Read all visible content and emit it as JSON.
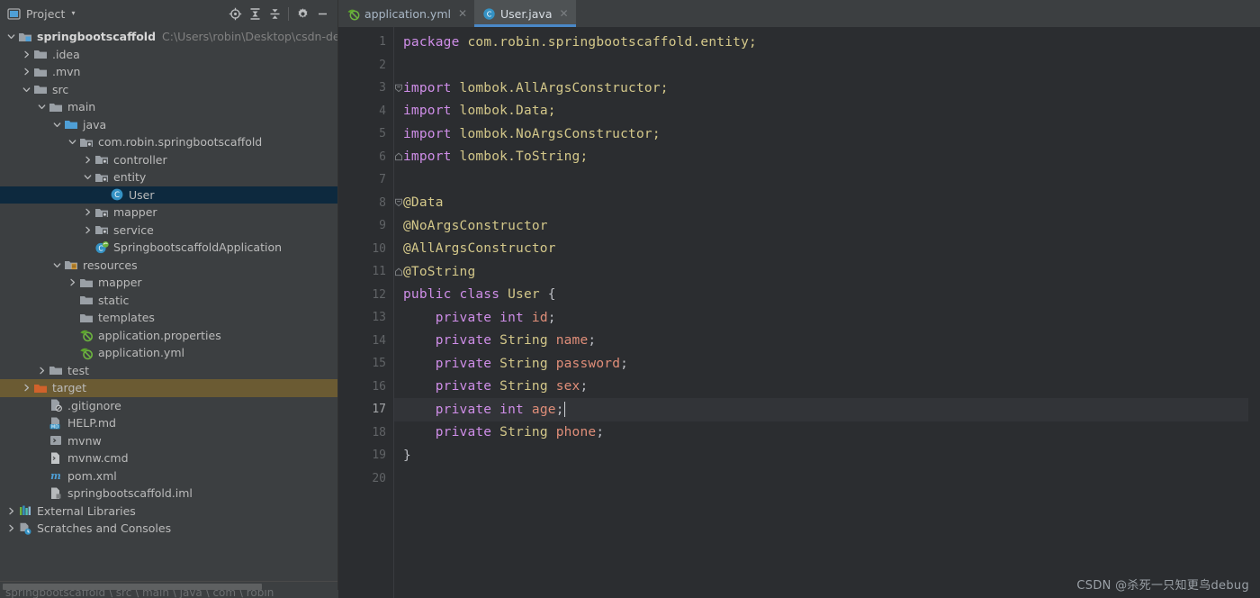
{
  "window": {
    "tool_window_title": "Project",
    "caret_glyph": "▾"
  },
  "toolbar": {
    "buttons": [
      {
        "name": "locate-icon",
        "title": "Select Opened File"
      },
      {
        "name": "expand-all-icon",
        "title": "Expand All"
      },
      {
        "name": "collapse-all-icon",
        "title": "Collapse All"
      },
      {
        "name": "gear-icon",
        "title": "Settings"
      },
      {
        "name": "minimize-icon",
        "title": "Hide"
      }
    ]
  },
  "tabs": [
    {
      "label": "application.yml",
      "icon": "spring-yaml-icon",
      "active": false,
      "close_glyph": "✕"
    },
    {
      "label": "User.java",
      "icon": "java-class-icon",
      "active": true,
      "close_glyph": "✕"
    }
  ],
  "project_tree": [
    {
      "label": "springbootscaffold",
      "path": "C:\\Users\\robin\\Desktop\\csdn-demo\\s",
      "indent": 0,
      "arrow": "down",
      "icon": "module-folder-icon",
      "bold": true,
      "state": "normal"
    },
    {
      "label": ".idea",
      "indent": 1,
      "arrow": "right",
      "icon": "folder-icon",
      "state": "normal"
    },
    {
      "label": ".mvn",
      "indent": 1,
      "arrow": "right",
      "icon": "folder-icon",
      "state": "normal"
    },
    {
      "label": "src",
      "indent": 1,
      "arrow": "down",
      "icon": "folder-icon",
      "state": "normal"
    },
    {
      "label": "main",
      "indent": 2,
      "arrow": "down",
      "icon": "folder-icon",
      "state": "normal"
    },
    {
      "label": "java",
      "indent": 3,
      "arrow": "down",
      "icon": "source-folder-icon",
      "state": "normal"
    },
    {
      "label": "com.robin.springbootscaffold",
      "indent": 4,
      "arrow": "down",
      "icon": "package-icon",
      "state": "normal"
    },
    {
      "label": "controller",
      "indent": 5,
      "arrow": "right",
      "icon": "package-icon",
      "state": "normal"
    },
    {
      "label": "entity",
      "indent": 5,
      "arrow": "down",
      "icon": "package-icon",
      "state": "normal"
    },
    {
      "label": "User",
      "indent": 6,
      "arrow": "none",
      "icon": "java-class-icon",
      "state": "selected"
    },
    {
      "label": "mapper",
      "indent": 5,
      "arrow": "right",
      "icon": "package-icon",
      "state": "normal"
    },
    {
      "label": "service",
      "indent": 5,
      "arrow": "right",
      "icon": "package-icon",
      "state": "normal"
    },
    {
      "label": "SpringbootscaffoldApplication",
      "indent": 5,
      "arrow": "none",
      "icon": "spring-boot-icon",
      "state": "normal"
    },
    {
      "label": "resources",
      "indent": 3,
      "arrow": "down",
      "icon": "resources-folder-icon",
      "state": "normal"
    },
    {
      "label": "mapper",
      "indent": 4,
      "arrow": "right",
      "icon": "folder-icon",
      "state": "normal"
    },
    {
      "label": "static",
      "indent": 4,
      "arrow": "none",
      "icon": "folder-icon",
      "state": "normal"
    },
    {
      "label": "templates",
      "indent": 4,
      "arrow": "none",
      "icon": "folder-icon",
      "state": "normal"
    },
    {
      "label": "application.properties",
      "indent": 4,
      "arrow": "none",
      "icon": "spring-yaml-icon",
      "state": "normal"
    },
    {
      "label": "application.yml",
      "indent": 4,
      "arrow": "none",
      "icon": "spring-yaml-icon",
      "state": "normal"
    },
    {
      "label": "test",
      "indent": 2,
      "arrow": "right",
      "icon": "folder-icon",
      "state": "normal"
    },
    {
      "label": "target",
      "indent": 1,
      "arrow": "right",
      "icon": "excluded-folder-icon",
      "state": "target"
    },
    {
      "label": ".gitignore",
      "indent": 2,
      "arrow": "none",
      "icon": "gitignore-icon",
      "state": "normal"
    },
    {
      "label": "HELP.md",
      "indent": 2,
      "arrow": "none",
      "icon": "markdown-icon",
      "state": "normal"
    },
    {
      "label": "mvnw",
      "indent": 2,
      "arrow": "none",
      "icon": "script-icon",
      "state": "normal"
    },
    {
      "label": "mvnw.cmd",
      "indent": 2,
      "arrow": "none",
      "icon": "cmd-file-icon",
      "state": "normal"
    },
    {
      "label": "pom.xml",
      "indent": 2,
      "arrow": "none",
      "icon": "maven-icon",
      "state": "normal"
    },
    {
      "label": "springbootscaffold.iml",
      "indent": 2,
      "arrow": "none",
      "icon": "iml-file-icon",
      "state": "normal"
    },
    {
      "label": "External Libraries",
      "indent": 0,
      "arrow": "right",
      "icon": "libraries-icon",
      "state": "normal"
    },
    {
      "label": "Scratches and Consoles",
      "indent": 0,
      "arrow": "right",
      "icon": "scratches-icon",
      "state": "normal"
    }
  ],
  "editor": {
    "language": "java",
    "current_line": 17,
    "total_lines": 20,
    "lines": [
      {
        "n": 1,
        "fold": "none",
        "tokens": [
          {
            "t": "package ",
            "c": "k"
          },
          {
            "t": "com.robin.springbootscaffold.entity;",
            "c": "ty"
          }
        ]
      },
      {
        "n": 2,
        "fold": "none",
        "tokens": []
      },
      {
        "n": 3,
        "fold": "open",
        "tokens": [
          {
            "t": "import ",
            "c": "k"
          },
          {
            "t": "lombok.AllArgsConstructor;",
            "c": "ty"
          }
        ]
      },
      {
        "n": 4,
        "fold": "none",
        "tokens": [
          {
            "t": "import ",
            "c": "k"
          },
          {
            "t": "lombok.Data;",
            "c": "ty"
          }
        ]
      },
      {
        "n": 5,
        "fold": "none",
        "tokens": [
          {
            "t": "import ",
            "c": "k"
          },
          {
            "t": "lombok.NoArgsConstructor;",
            "c": "ty"
          }
        ]
      },
      {
        "n": 6,
        "fold": "close",
        "tokens": [
          {
            "t": "import ",
            "c": "k"
          },
          {
            "t": "lombok.ToString;",
            "c": "ty"
          }
        ]
      },
      {
        "n": 7,
        "fold": "none",
        "tokens": []
      },
      {
        "n": 8,
        "fold": "open",
        "tokens": [
          {
            "t": "@Data",
            "c": "ty"
          }
        ]
      },
      {
        "n": 9,
        "fold": "none",
        "tokens": [
          {
            "t": "@NoArgsConstructor",
            "c": "ty"
          }
        ]
      },
      {
        "n": 10,
        "fold": "none",
        "tokens": [
          {
            "t": "@AllArgsConstructor",
            "c": "ty"
          }
        ]
      },
      {
        "n": 11,
        "fold": "close",
        "tokens": [
          {
            "t": "@ToString",
            "c": "ty"
          }
        ]
      },
      {
        "n": 12,
        "fold": "none",
        "tokens": [
          {
            "t": "public class ",
            "c": "k"
          },
          {
            "t": "User",
            "c": "ty"
          },
          {
            "t": " {",
            "c": "pl"
          }
        ]
      },
      {
        "n": 13,
        "fold": "none",
        "tokens": [
          {
            "t": "    private int ",
            "c": "k"
          },
          {
            "t": "id",
            "c": "fl"
          },
          {
            "t": ";",
            "c": "pl"
          }
        ]
      },
      {
        "n": 14,
        "fold": "none",
        "tokens": [
          {
            "t": "    private ",
            "c": "k"
          },
          {
            "t": "String ",
            "c": "ty"
          },
          {
            "t": "name",
            "c": "fl"
          },
          {
            "t": ";",
            "c": "pl"
          }
        ]
      },
      {
        "n": 15,
        "fold": "none",
        "tokens": [
          {
            "t": "    private ",
            "c": "k"
          },
          {
            "t": "String ",
            "c": "ty"
          },
          {
            "t": "password",
            "c": "fl"
          },
          {
            "t": ";",
            "c": "pl"
          }
        ]
      },
      {
        "n": 16,
        "fold": "none",
        "tokens": [
          {
            "t": "    private ",
            "c": "k"
          },
          {
            "t": "String ",
            "c": "ty"
          },
          {
            "t": "sex",
            "c": "fl"
          },
          {
            "t": ";",
            "c": "pl"
          }
        ]
      },
      {
        "n": 17,
        "fold": "none",
        "caret": true,
        "tokens": [
          {
            "t": "    private int ",
            "c": "k"
          },
          {
            "t": "age",
            "c": "fl"
          },
          {
            "t": ";",
            "c": "pl"
          }
        ]
      },
      {
        "n": 18,
        "fold": "none",
        "tokens": [
          {
            "t": "    private ",
            "c": "k"
          },
          {
            "t": "String ",
            "c": "ty"
          },
          {
            "t": "phone",
            "c": "fl"
          },
          {
            "t": ";",
            "c": "pl"
          }
        ]
      },
      {
        "n": 19,
        "fold": "none",
        "tokens": [
          {
            "t": "}",
            "c": "pl"
          }
        ]
      },
      {
        "n": 20,
        "fold": "none",
        "tokens": []
      }
    ]
  },
  "watermark": {
    "text": "CSDN @杀死一只知更鸟debug"
  },
  "status_bar": {
    "breadcrumb": "springbootscaffold \\ src \\ main \\ java \\ com \\ robin"
  },
  "colors": {
    "panel_bg": "#3c3f41",
    "editor_bg": "#2b2d30",
    "selection_bg": "#0d293e",
    "target_bg": "#6b5b33",
    "tab_active_bg": "#4e5254",
    "tab_underline": "#4a88c7",
    "keyword": "#cf8ee8",
    "type": "#d4c88a",
    "field": "#e08e79",
    "plain": "#bcbec4",
    "line_number": "#606366",
    "current_line_bg": "#323438"
  }
}
